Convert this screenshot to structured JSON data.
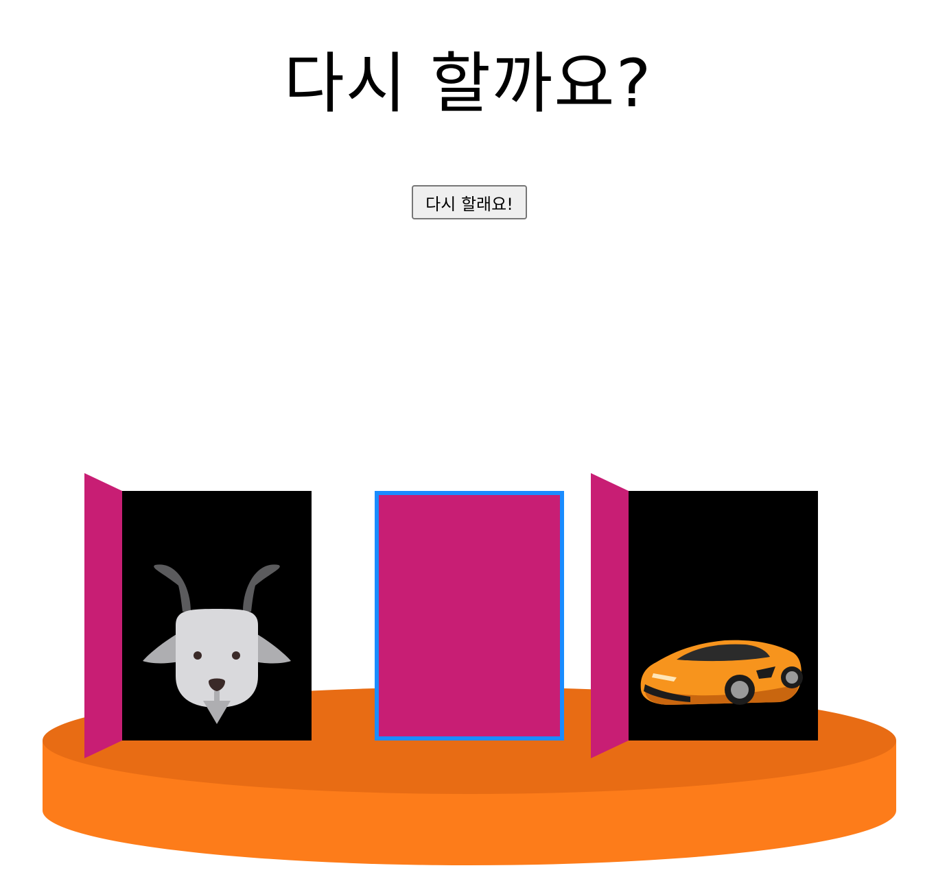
{
  "header": {
    "title": "다시 할까요?"
  },
  "controls": {
    "retry_label": "다시 할래요!"
  },
  "doors": [
    {
      "state": "open",
      "prize": "goat-icon"
    },
    {
      "state": "closed",
      "selected": true
    },
    {
      "state": "open",
      "prize": "car-icon"
    }
  ],
  "colors": {
    "door": "#c81e74",
    "selection_border": "#1a8cff",
    "stage_top": "#e86c14",
    "stage_side": "#fd7c1a",
    "door_interior": "#000000"
  }
}
